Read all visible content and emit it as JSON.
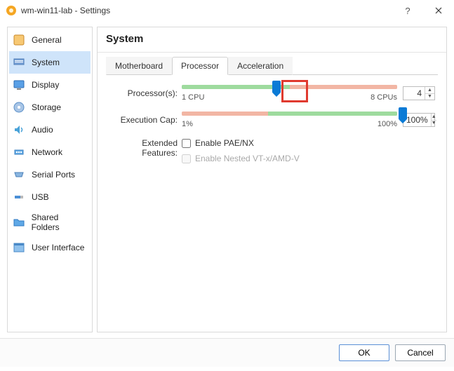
{
  "title": "wm-win11-lab - Settings",
  "sidebar": {
    "items": [
      {
        "label": "General"
      },
      {
        "label": "System"
      },
      {
        "label": "Display"
      },
      {
        "label": "Storage"
      },
      {
        "label": "Audio"
      },
      {
        "label": "Network"
      },
      {
        "label": "Serial Ports"
      },
      {
        "label": "USB"
      },
      {
        "label": "Shared Folders"
      },
      {
        "label": "User Interface"
      }
    ],
    "active_index": 1
  },
  "heading": "System",
  "tabs": {
    "items": [
      {
        "label": "Motherboard"
      },
      {
        "label": "Processor"
      },
      {
        "label": "Acceleration"
      }
    ],
    "active_index": 1
  },
  "processor": {
    "label": "Processor(s):",
    "min_label": "1 CPU",
    "max_label": "8 CPUs",
    "value": "4",
    "green_pct": 50,
    "red_pct": 50,
    "thumb_pct": 43
  },
  "exec_cap": {
    "label": "Execution Cap:",
    "min_label": "1%",
    "max_label": "100%",
    "value": "100%",
    "red_pct": 40,
    "green_pct": 60,
    "thumb_pct": 100
  },
  "extended": {
    "label": "Extended Features:",
    "pae": "Enable PAE/NX",
    "nested": "Enable Nested VT-x/AMD-V"
  },
  "buttons": {
    "ok": "OK",
    "cancel": "Cancel"
  }
}
